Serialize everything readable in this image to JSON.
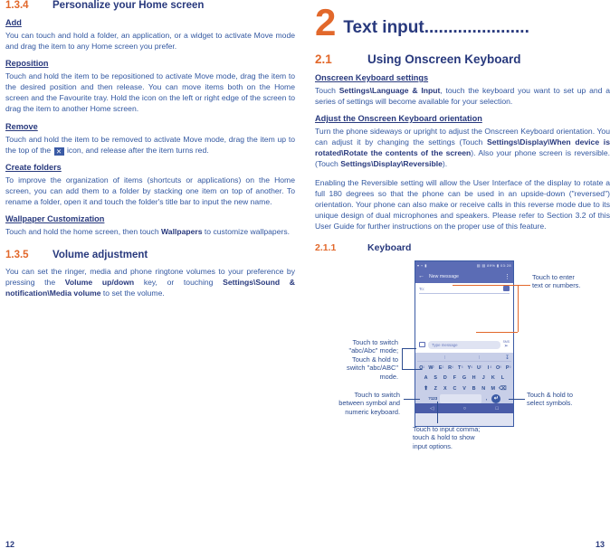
{
  "left_column": {
    "section": {
      "number": "1.3.4",
      "title": "Personalize your Home screen"
    },
    "blocks": [
      {
        "heading": "Add",
        "text": "You can touch and hold a folder, an application, or a widget to activate Move mode and drag the item to any Home screen you prefer."
      },
      {
        "heading": "Reposition ",
        "text": "Touch and hold the item to be repositioned to activate Move mode, drag the item to the desired position and then release. You can move items both on the Home screen and the Favourite tray. Hold the icon on the left or right edge of the screen to drag the item to another Home screen."
      },
      {
        "heading": "Remove",
        "text_before": "Touch and hold the item to be removed to activate Move mode, drag the item up to the top of the ",
        "icon": "close-x-icon",
        "icon_glyph": "✕",
        "text_after": " icon, and release after the item turns red."
      },
      {
        "heading": "Create folders",
        "text": "To improve the organization of items (shortcuts or applications) on the Home screen, you can add them to a folder by stacking one item on top of another. To rename a folder, open it and touch the folder's title bar to input the new name."
      },
      {
        "heading": "Wallpaper Customization",
        "text_before": "Touch and hold the home screen, then touch ",
        "bold": "Wallpapers",
        "text_after": " to customize wallpapers."
      }
    ],
    "section2": {
      "number": "1.3.5",
      "title": "Volume adjustment"
    },
    "section2_text": {
      "p1": "You can set the ringer, media and phone ringtone volumes to your preference by pressing the ",
      "b1": "Volume up/down",
      "p2": " key, or touching ",
      "b2": "Settings\\Sound & notification\\Media volume",
      "p3": " to set the volume."
    },
    "page_number": "12"
  },
  "right_column": {
    "chapter": {
      "number": "2",
      "title": "Text input",
      "dots": "......................"
    },
    "section": {
      "number": "2.1",
      "title": "Using Onscreen Keyboard"
    },
    "subsection1": {
      "heading": "Onscreen Keyboard settings",
      "t1": "Touch ",
      "b1": "Settings\\Language & Input",
      "t2": ", touch the keyboard you want to set up and a series of settings will become available for your selection."
    },
    "subsection2": {
      "heading": "Adjust the Onscreen Keyboard orientation",
      "t1": "Turn the phone sideways or upright to adjust the Onscreen Keyboard orientation. You can adjust it by changing the settings (Touch ",
      "b1": "Settings\\Display\\When device is rotated\\Rotate the contents of the screen",
      "t2": "). Also your phone screen is reversible. (Touch ",
      "b2": "Settings\\Display\\Reversible",
      "t3": ").",
      "p2": "Enabling the Reversible setting will allow the User Interface of the display to rotate a full 180 degrees so that the phone can be used in an upside-down (\"reversed\") orientation. Your phone can also make or receive calls in this reverse mode due to its unique design of dual microphones and speakers. Please refer to Section 3.2 of this User Guide for further instructions on the proper use of this feature."
    },
    "subsection3": {
      "number": "2.1.1",
      "title": "Keyboard"
    },
    "page_number": "13"
  },
  "figure": {
    "phone": {
      "statusbar": {
        "left_icons": "▾ ⌁ ▮",
        "right_icons": "▤ ▤ 89% ▮ 03:28"
      },
      "appbar": {
        "back_icon": "←",
        "title": "New message",
        "menu_icon": "⋮"
      },
      "composer": {
        "to_label": "To:",
        "contact_icon": "add-contact-icon",
        "attach_icon": "attach-icon",
        "message_placeholder": "Type message",
        "send_icon": "➢",
        "sms_tag": "SMS"
      },
      "keyboard": {
        "mic_icon": "🎤",
        "row1": [
          {
            "key": "Q",
            "sup": "1"
          },
          {
            "key": "W",
            "sup": "2"
          },
          {
            "key": "E",
            "sup": "3"
          },
          {
            "key": "R",
            "sup": "4"
          },
          {
            "key": "T",
            "sup": "5"
          },
          {
            "key": "Y",
            "sup": "6"
          },
          {
            "key": "U",
            "sup": "7"
          },
          {
            "key": "I",
            "sup": "8"
          },
          {
            "key": "O",
            "sup": "9"
          },
          {
            "key": "P",
            "sup": "0"
          }
        ],
        "row2": [
          "A",
          "S",
          "D",
          "F",
          "G",
          "H",
          "J",
          "K",
          "L"
        ],
        "row3_shift": "⬆",
        "row3": [
          "Z",
          "X",
          "C",
          "V",
          "B",
          "N",
          "M"
        ],
        "row3_del": "⌫",
        "row4_num": "?123",
        "row4_comma": ",",
        "row4_space": "",
        "row4_enter": "↵"
      },
      "navbar": {
        "back": "◁",
        "home": "○",
        "recent": "□"
      }
    },
    "callouts": [
      {
        "name": "enter-text-callout",
        "text": "Touch to enter\ntext or numbers.",
        "line1": "Touch to enter",
        "line2": "text or numbers."
      },
      {
        "name": "abc-mode-callout",
        "line1": "Touch to switch",
        "line2": "\"abc/Abc\" mode;",
        "line3": "Touch & hold to",
        "line4": "switch \"abc/ABC\"",
        "line5": "mode."
      },
      {
        "name": "symbol-numeric-callout",
        "line1": "Touch to switch",
        "line2": "between symbol and",
        "line3": "numeric keyboard."
      },
      {
        "name": "select-symbols-callout",
        "line1": "Touch & hold to",
        "line2": "select symbols."
      },
      {
        "name": "comma-callout",
        "line1": "Touch to input comma;",
        "line2": "touch & hold to show",
        "line3": "input options."
      }
    ]
  },
  "colors": {
    "accent_orange": "#e2682b",
    "heading_blue": "#28397d",
    "body_blue": "#3257a0",
    "phone_ui": "#5b6cb5"
  }
}
